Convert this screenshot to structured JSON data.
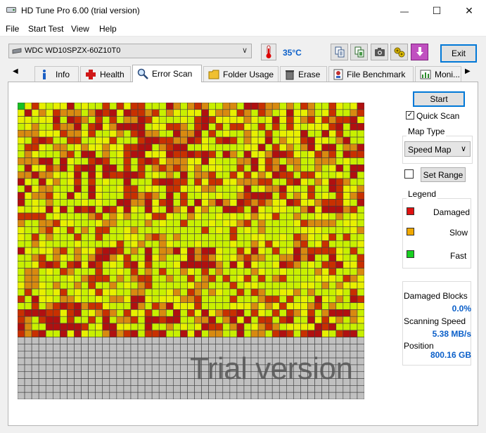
{
  "window": {
    "title": "HD Tune Pro 6.00 (trial version)",
    "minimize_glyph": "—",
    "maximize_glyph": "☐",
    "close_glyph": "✕"
  },
  "menu": [
    "File",
    "Start Test",
    "View",
    "Help"
  ],
  "drive": {
    "selected": "WDC WD10SPZX-60Z10T0",
    "temperature": "35°C"
  },
  "toolbar": {
    "icons": [
      "copy-text-icon",
      "copy-info-icon",
      "screenshot-camera-icon",
      "options-gears-icon",
      "save-download-icon"
    ],
    "exit_label": "Exit"
  },
  "tabs": [
    {
      "label": "Info",
      "icon": "info-icon",
      "active": false
    },
    {
      "label": "Health",
      "icon": "health-cross-icon",
      "active": false
    },
    {
      "label": "Error Scan",
      "icon": "magnifier-icon",
      "active": true
    },
    {
      "label": "Folder Usage",
      "icon": "folder-icon",
      "active": false
    },
    {
      "label": "Erase",
      "icon": "trash-icon",
      "active": false
    },
    {
      "label": "File Benchmark",
      "icon": "file-benchmark-icon",
      "active": false
    },
    {
      "label": "Moni...",
      "icon": "monitor-chart-icon",
      "active": false
    }
  ],
  "scan": {
    "start_label": "Start",
    "quick_scan_label": "Quick Scan",
    "quick_scan_checked": true,
    "map_type_title": "Map Type",
    "map_type_value": "Speed Map",
    "set_range_label": "Set Range",
    "set_range_checked": false,
    "legend_title": "Legend",
    "legend": [
      {
        "label": "Damaged",
        "color": "#e01010"
      },
      {
        "label": "Slow",
        "color": "#f0a800"
      },
      {
        "label": "Fast",
        "color": "#18d020"
      }
    ],
    "stats": [
      {
        "label": "Damaged Blocks",
        "value": "0.0%"
      },
      {
        "label": "Scanning Speed",
        "value": "5.38 MB/s"
      },
      {
        "label": "Position",
        "value": "800.16 GB"
      }
    ],
    "watermark": "Trial version"
  },
  "map": {
    "columns": 49,
    "rows": 43,
    "scanned_rows": 34,
    "scanned_cols_in_last_row": 49,
    "palette": {
      "fast_bright": "#c8f000",
      "fast_yellow": "#e8f000",
      "medium": "#d88a10",
      "slow_red": "#c83000",
      "damaged": "#b01010",
      "unscanned": "#c0c0c0",
      "first_block": "#18c020",
      "grid": "#404040"
    }
  }
}
